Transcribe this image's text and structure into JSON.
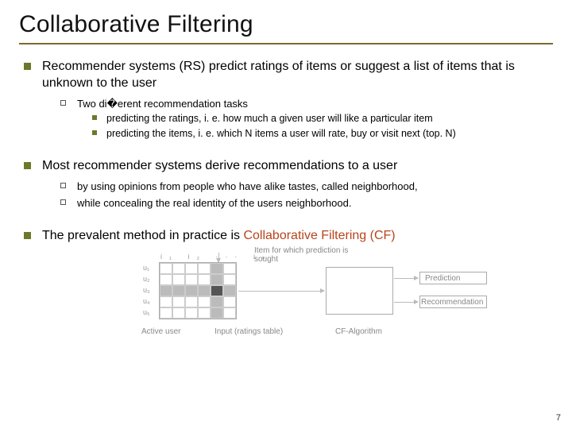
{
  "title": "Collaborative Filtering",
  "b1": {
    "text": "Recommender systems (RS) predict ratings of items or suggest a list of items that is unknown to the user",
    "sub": {
      "text": "Two di�erent recommendation tasks",
      "items": [
        "predicting the ratings, i. e. how much a given user will like a particular item",
        "predicting the items, i. e. which N items a user will rate, buy or visit next (top. N)"
      ]
    }
  },
  "b2": {
    "text": "Most recommender systems derive recommendations to a user",
    "subs": [
      "by using opinions from people who have alike tastes, called neighborhood,",
      "while concealing the real identity of the users neighborhood."
    ]
  },
  "b3": {
    "prefix": "The prevalent method in practice is ",
    "highlight": "Collaborative Filtering (CF)"
  },
  "diagram": {
    "item_label": "Item for which prediction is sought",
    "rows": [
      "u₁",
      "u₂",
      "u₃",
      "u₄",
      "u₅"
    ],
    "cols": "i₁ i₂ ··· iₙ",
    "active_user": "Active user",
    "input_label": "Input (ratings table)",
    "cf_label": "CF-Algorithm",
    "out1": "Prediction",
    "out2": "Recommendation"
  },
  "page": "7"
}
